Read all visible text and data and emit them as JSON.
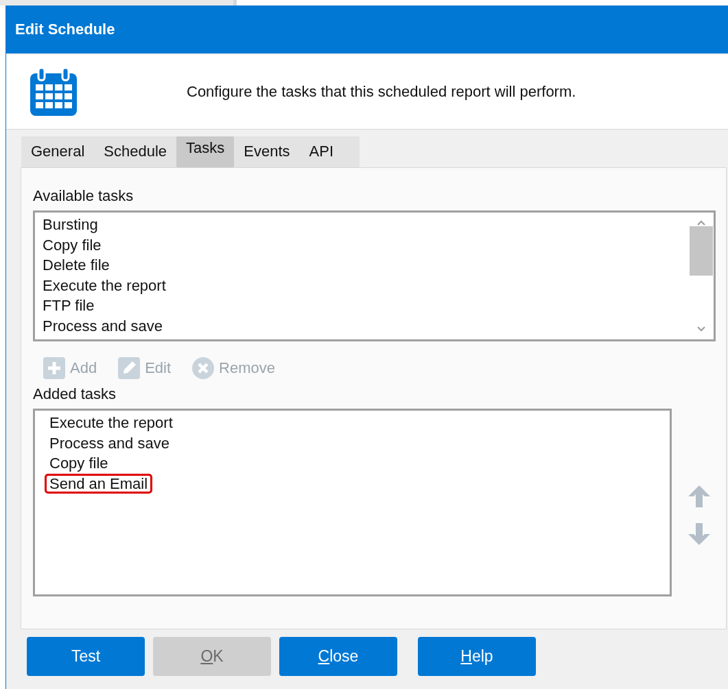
{
  "window": {
    "title": "Edit Schedule"
  },
  "header": {
    "description": "Configure the tasks that this scheduled report will perform."
  },
  "tabs": [
    {
      "label": "General",
      "selected": false
    },
    {
      "label": "Schedule",
      "selected": false
    },
    {
      "label": "Tasks",
      "selected": true
    },
    {
      "label": "Events",
      "selected": false
    },
    {
      "label": "API",
      "selected": false
    }
  ],
  "available_tasks": {
    "label": "Available tasks",
    "items": [
      {
        "label": "Bursting",
        "selected": false
      },
      {
        "label": "Copy file",
        "selected": false
      },
      {
        "label": "Delete file",
        "selected": false
      },
      {
        "label": "Execute the report",
        "selected": false
      },
      {
        "label": "FTP file",
        "selected": false
      },
      {
        "label": "Process and save",
        "selected": false
      }
    ]
  },
  "task_actions": [
    {
      "kind": "add",
      "label": "Add",
      "disabled": true
    },
    {
      "kind": "edit",
      "label": "Edit",
      "disabled": true
    },
    {
      "kind": "remove",
      "label": "Remove",
      "disabled": true
    }
  ],
  "added_tasks": {
    "label": "Added tasks",
    "items": [
      {
        "label": "Execute the report",
        "highlighted": false
      },
      {
        "label": "Process and save",
        "highlighted": false
      },
      {
        "label": "Copy file",
        "highlighted": false
      },
      {
        "label": "Send an Email",
        "highlighted": true
      }
    ]
  },
  "reorder": [
    {
      "kind": "up",
      "disabled": true
    },
    {
      "kind": "down",
      "disabled": true
    }
  ],
  "buttons": [
    {
      "label": "Test",
      "disabled": false,
      "mnemonic": false
    },
    {
      "label": "OK",
      "disabled": true,
      "mnemonic": true
    },
    {
      "label": "Close",
      "disabled": false,
      "mnemonic": true
    },
    {
      "label": "Help",
      "disabled": false,
      "mnemonic": true
    }
  ]
}
